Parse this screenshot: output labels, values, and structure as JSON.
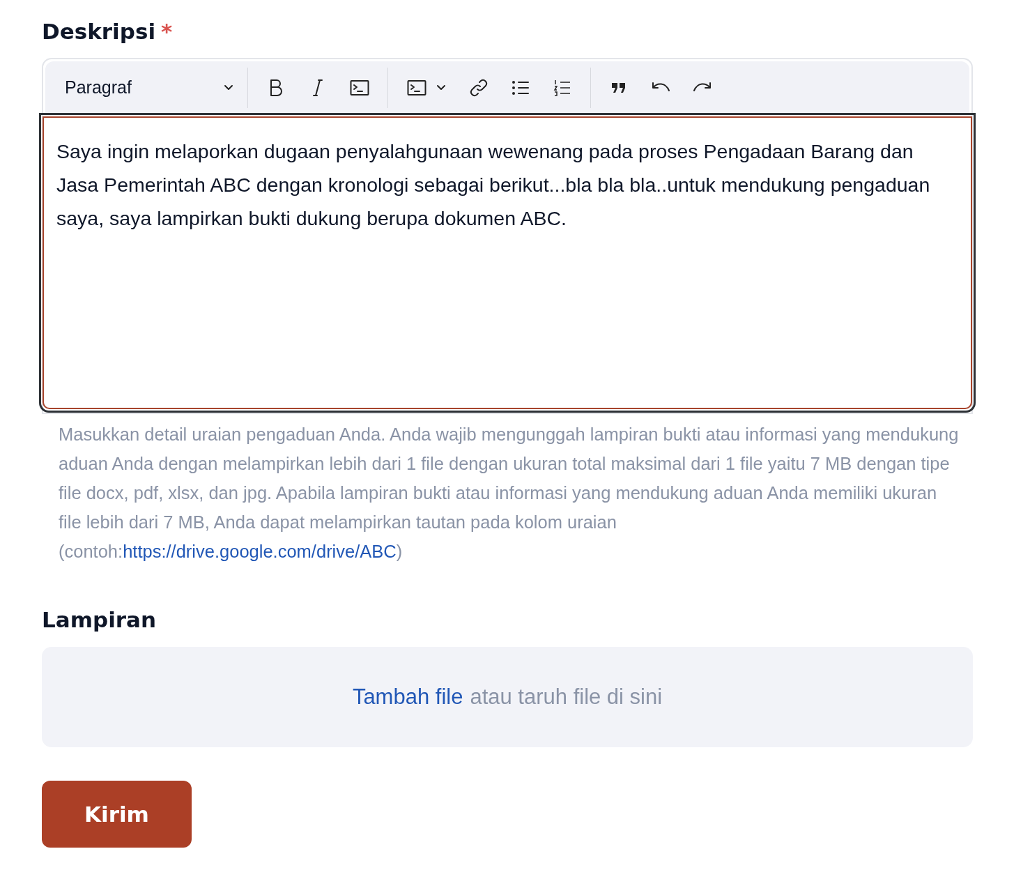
{
  "description_field": {
    "label": "Deskripsi",
    "required_mark": "*",
    "toolbar": {
      "block_style": "Paragraf"
    },
    "content": "Saya ingin melaporkan dugaan penyalahgunaan wewenang pada proses Pengadaan Barang dan Jasa Pemerintah ABC dengan kronologi sebagai berikut...bla bla bla..untuk mendukung pengaduan saya, saya lampirkan bukti dukung berupa dokumen ABC.",
    "help_text": "Masukkan detail uraian pengaduan Anda. Anda wajib mengunggah lampiran bukti atau informasi yang mendukung aduan Anda dengan melampirkan lebih dari 1 file dengan ukuran total maksimal dari 1 file yaitu 7 MB dengan tipe file docx, pdf, xlsx, dan jpg. Apabila lampiran bukti atau informasi yang mendukung aduan Anda memiliki ukuran file lebih dari 7 MB, Anda dapat melampirkan tautan pada kolom uraian (contoh:",
    "help_link": "https://drive.google.com/drive/ABC",
    "help_suffix": ")"
  },
  "attachment_field": {
    "label": "Lampiran",
    "dropzone_link": "Tambah file",
    "dropzone_text": "atau taruh file di sini"
  },
  "submit_button": "Kirim"
}
